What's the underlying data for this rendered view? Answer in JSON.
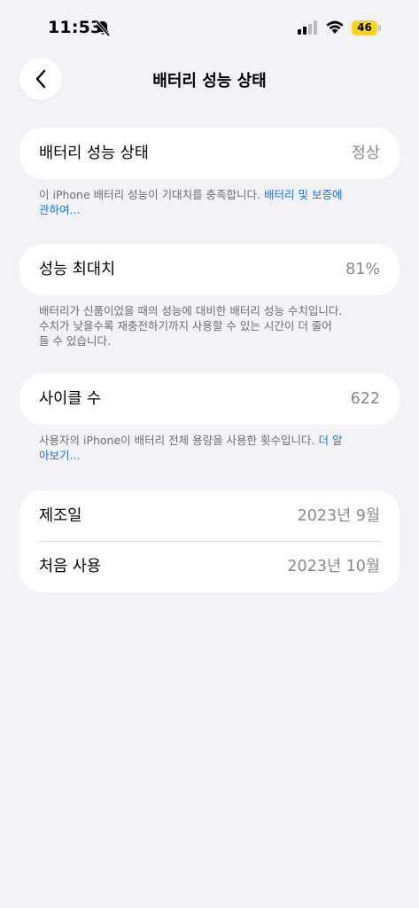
{
  "status_bar": {
    "time": "11:53",
    "battery_percent": "46",
    "battery_color": "#ffd60a",
    "icons": [
      "bell-slash-icon",
      "cellular-signal-icon",
      "wifi-icon",
      "battery-icon"
    ]
  },
  "nav": {
    "title": "배터리 성능 상태",
    "back_icon": "chevron-left-icon"
  },
  "battery_health": {
    "label": "배터리 성능 상태",
    "value": "정상",
    "note_text": "이 iPhone 배터리 성능이 기대치를 충족합니다. ",
    "note_link_1": "배터리 및 보증에",
    "note_link_2": "관하여..."
  },
  "max_capacity": {
    "label": "성능 최대치",
    "value": "81%",
    "note_line1": "배터리가 신품이었을 때의 성능에 대비한 배터리 성능 수치입니다.",
    "note_line2": "수치가 낮을수록 재충전하기까지 사용할 수 있는 시간이 더 줄어",
    "note_line3": "들 수 있습니다."
  },
  "cycle_count": {
    "label": "사이클 수",
    "value": "622",
    "note_text": "사용자의 iPhone이 배터리 전체 용량을 사용한 횟수입니다. ",
    "note_link_1": "더 알",
    "note_link_2": "아보기..."
  },
  "dates": {
    "manufacture_label": "제조일",
    "manufacture_value": "2023년 9월",
    "first_use_label": "처음 사용",
    "first_use_value": "2023년 10월"
  },
  "colors": {
    "background": "#f2f2f7",
    "card": "#ffffff",
    "secondary_text": "#8a8a8e",
    "link": "#1a73e8"
  }
}
